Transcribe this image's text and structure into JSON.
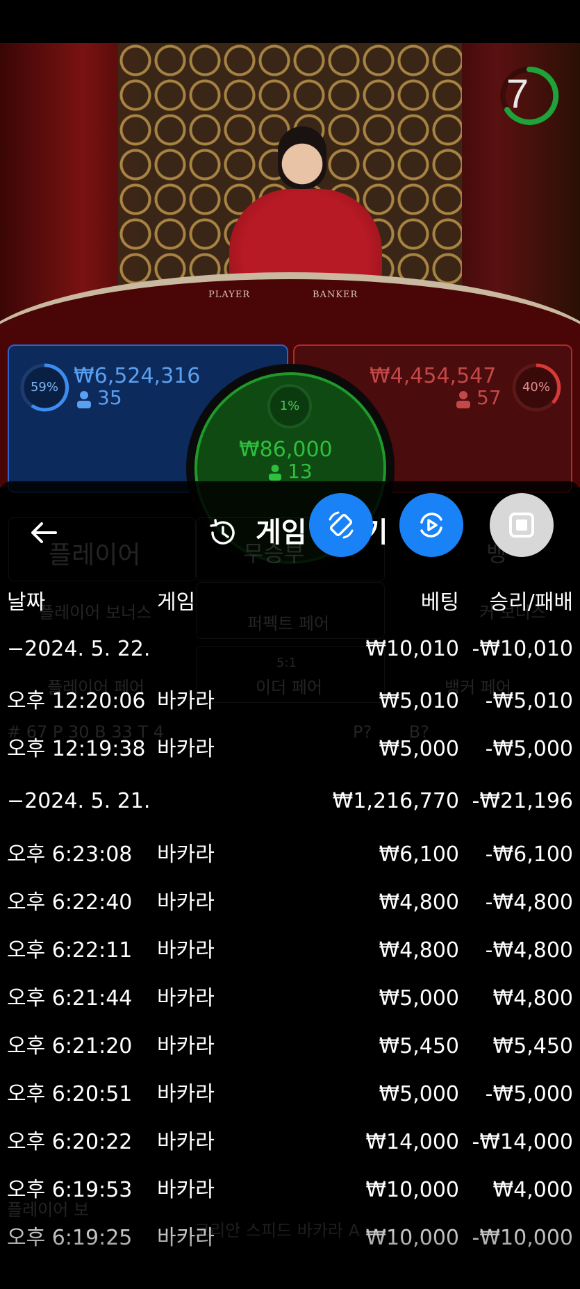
{
  "game_view": {
    "timer": "7",
    "table_labels": [
      "PLAYER",
      "BANKER"
    ],
    "player": {
      "percent": "59%",
      "amount": "₩6,524,316",
      "count": "35"
    },
    "banker": {
      "percent": "40%",
      "amount": "₩4,454,547",
      "count": "57"
    },
    "tie": {
      "percent": "1%",
      "amount": "₩86,000",
      "count": "13"
    },
    "colors": {
      "player": "#2a64c7",
      "banker": "#b02a2a",
      "tie": "#1f9a2a"
    }
  },
  "background_ghost": {
    "player_label": "플레이어",
    "tie_label": "무승부",
    "banker_label": "뱅",
    "player_bonus": "플레이어 보너스",
    "perfect_pair": "퍼펙트 페어",
    "banker_bonus": "커 보너스",
    "player_pair": "플레이어 페어",
    "either_pair": "이더 페어",
    "banker_pair": "뱅커 페어",
    "either_pair_odds": "5:1",
    "stats": "# 67   P 30   B 33   T 4",
    "preview": "P?       B?",
    "bottom_label": "플레이어 보",
    "bottom_table": "코리안 스피드 바카라 A"
  },
  "header": {
    "back_icon": "arrow-left-icon",
    "history_icon": "history-icon",
    "title": "게임",
    "title_suffix": "기"
  },
  "fabs": [
    {
      "icon": "rotate-device-icon",
      "color": "#1a82f7"
    },
    {
      "icon": "replay-video-icon",
      "color": "#1a82f7"
    },
    {
      "icon": "stop-square-icon",
      "color": "#d8d8d8"
    }
  ],
  "columns": {
    "date": "날짜",
    "game": "게임",
    "bet": "베팅",
    "result": "승리/패배"
  },
  "rows": [
    {
      "date": "−2024. 5. 22.",
      "game": "",
      "bet": "₩10,010",
      "result": "-₩10,010"
    },
    {
      "date": "오후 12:20:06",
      "game": "바카라",
      "bet": "₩5,010",
      "result": "-₩5,010"
    },
    {
      "date": "오후 12:19:38",
      "game": "바카라",
      "bet": "₩5,000",
      "result": "-₩5,000"
    },
    {
      "date": "−2024. 5. 21.",
      "game": "",
      "bet": "₩1,216,770",
      "result": "-₩21,196"
    },
    {
      "date": "오후 6:23:08",
      "game": "바카라",
      "bet": "₩6,100",
      "result": "-₩6,100"
    },
    {
      "date": "오후 6:22:40",
      "game": "바카라",
      "bet": "₩4,800",
      "result": "-₩4,800"
    },
    {
      "date": "오후 6:22:11",
      "game": "바카라",
      "bet": "₩4,800",
      "result": "-₩4,800"
    },
    {
      "date": "오후 6:21:44",
      "game": "바카라",
      "bet": "₩5,000",
      "result": "₩4,800"
    },
    {
      "date": "오후 6:21:20",
      "game": "바카라",
      "bet": "₩5,450",
      "result": "₩5,450"
    },
    {
      "date": "오후 6:20:51",
      "game": "바카라",
      "bet": "₩5,000",
      "result": "-₩5,000"
    },
    {
      "date": "오후 6:20:22",
      "game": "바카라",
      "bet": "₩14,000",
      "result": "-₩14,000"
    },
    {
      "date": "오후 6:19:53",
      "game": "바카라",
      "bet": "₩10,000",
      "result": "₩4,000"
    },
    {
      "date": "오후 6:19:25",
      "game": "바카라",
      "bet": "₩10,000",
      "result": "-₩10,000"
    }
  ]
}
